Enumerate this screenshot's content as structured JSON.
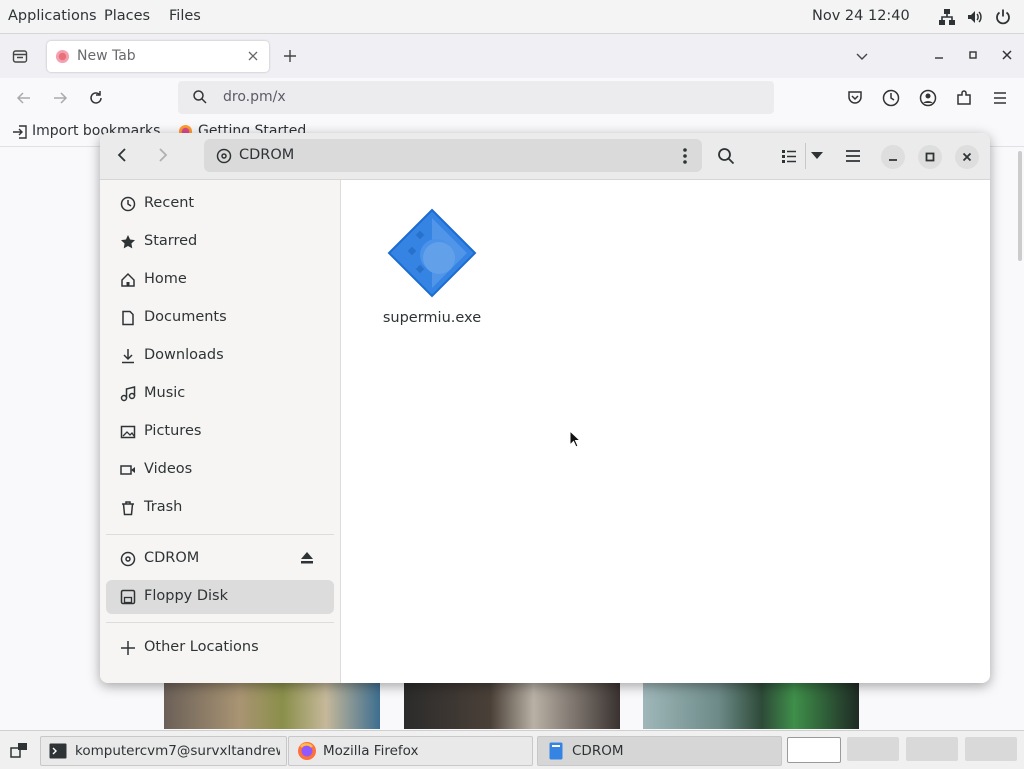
{
  "topbar": {
    "applications": "Applications",
    "places": "Places",
    "files": "Files",
    "clock": "Nov 24  12:40"
  },
  "firefox": {
    "tab_title": "New Tab",
    "url_text": "dro.pm/x",
    "bookmarks": [
      "Import bookmarks…",
      "Getting Started"
    ]
  },
  "nautilus": {
    "location": "CDROM",
    "sidebar": [
      {
        "label": "Recent",
        "icon": "clock-icon"
      },
      {
        "label": "Starred",
        "icon": "star-icon"
      },
      {
        "label": "Home",
        "icon": "home-icon"
      },
      {
        "label": "Documents",
        "icon": "document-icon"
      },
      {
        "label": "Downloads",
        "icon": "download-icon"
      },
      {
        "label": "Music",
        "icon": "music-icon"
      },
      {
        "label": "Pictures",
        "icon": "picture-icon"
      },
      {
        "label": "Videos",
        "icon": "video-icon"
      },
      {
        "label": "Trash",
        "icon": "trash-icon"
      }
    ],
    "devices": [
      {
        "label": "CDROM",
        "icon": "disc-icon"
      },
      {
        "label": "Floppy Disk",
        "icon": "floppy-icon",
        "selected": true
      }
    ],
    "other_locations": "Other Locations",
    "files": [
      {
        "name": "supermiu.exe",
        "icon": "executable-icon"
      }
    ]
  },
  "taskbar": {
    "tasks": [
      {
        "label": "komputercvm7@survxltandrew…",
        "icon": "terminal-icon"
      },
      {
        "label": "Mozilla Firefox",
        "icon": "firefox-icon"
      },
      {
        "label": "CDROM",
        "icon": "file-manager-icon"
      }
    ],
    "workspaces": 4,
    "current_workspace": 1
  }
}
